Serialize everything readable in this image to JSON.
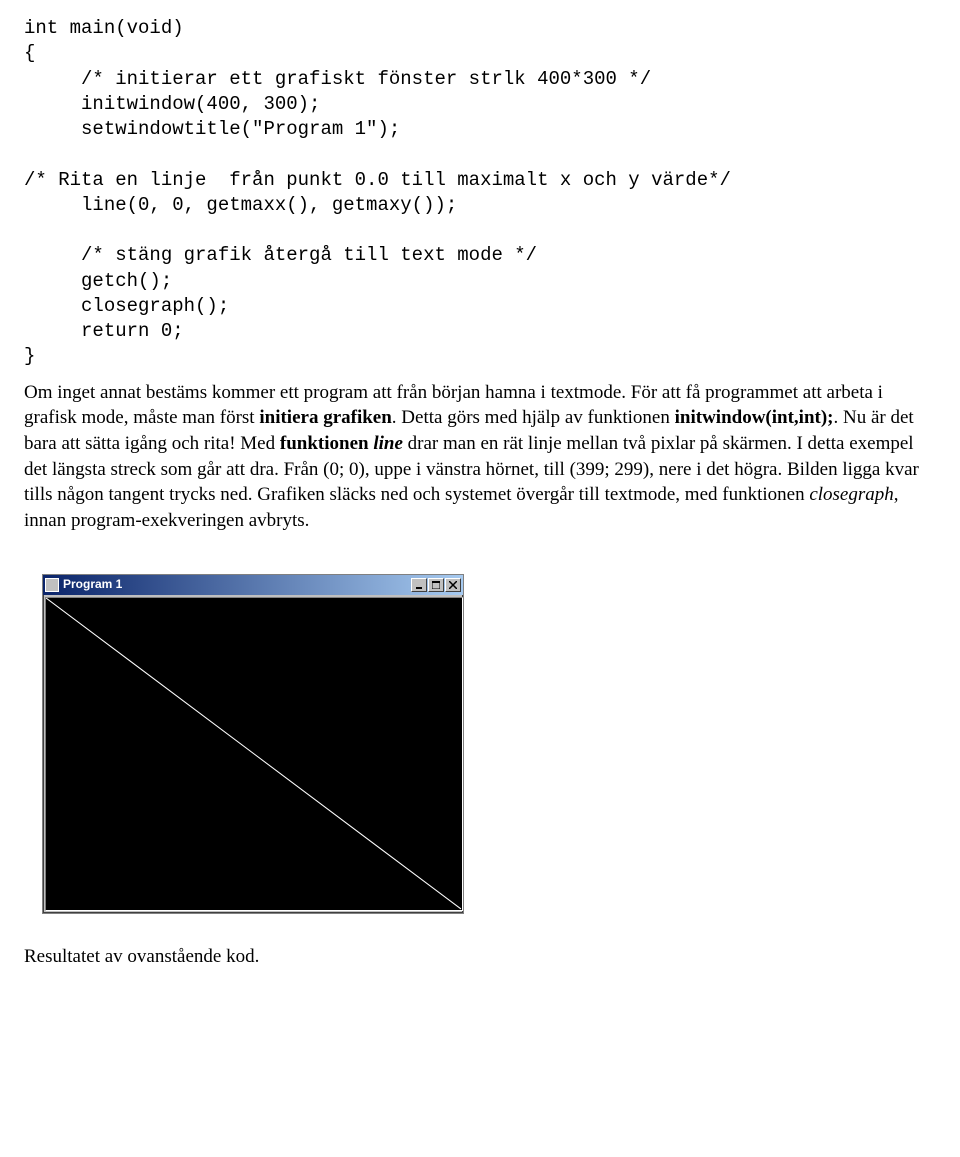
{
  "code": "int main(void)\n{\n     /* initierar ett grafiskt fönster strlk 400*300 */\n     initwindow(400, 300);\n     setwindowtitle(\"Program 1\");\n\n/* Rita en linje  från punkt 0.0 till maximalt x och y värde*/\n     line(0, 0, getmaxx(), getmaxy());\n\n     /* stäng grafik återgå till text mode */\n     getch();\n     closegraph();\n     return 0;\n}",
  "para": {
    "t1": "Om inget annat bestäms kommer ett program att från början hamna i textmode. För att få programmet att arbeta i grafisk mode, måste man först ",
    "b1": "initiera grafiken",
    "t2": ". Detta görs med hjälp av funktionen ",
    "b2": "initwindow(int,int);",
    "t3": ". Nu är det bara att sätta igång och rita! Med ",
    "b3": "funktionen ",
    "bi1": "line",
    "t4": " drar man en rät linje mellan två pixlar på skärmen. I detta exempel det längsta streck som går att dra. Från (0; 0), uppe i vänstra hörnet, till (399; 299), nere i det högra. Bilden ligga kvar tills någon tangent trycks ned. Grafiken släcks ned och systemet övergår till textmode, med funktionen ",
    "i1": "closegraph",
    "t5": ", innan program-exekveringen avbryts."
  },
  "window": {
    "title": "Program 1"
  },
  "caption": "Resultatet av ovanstående kod."
}
